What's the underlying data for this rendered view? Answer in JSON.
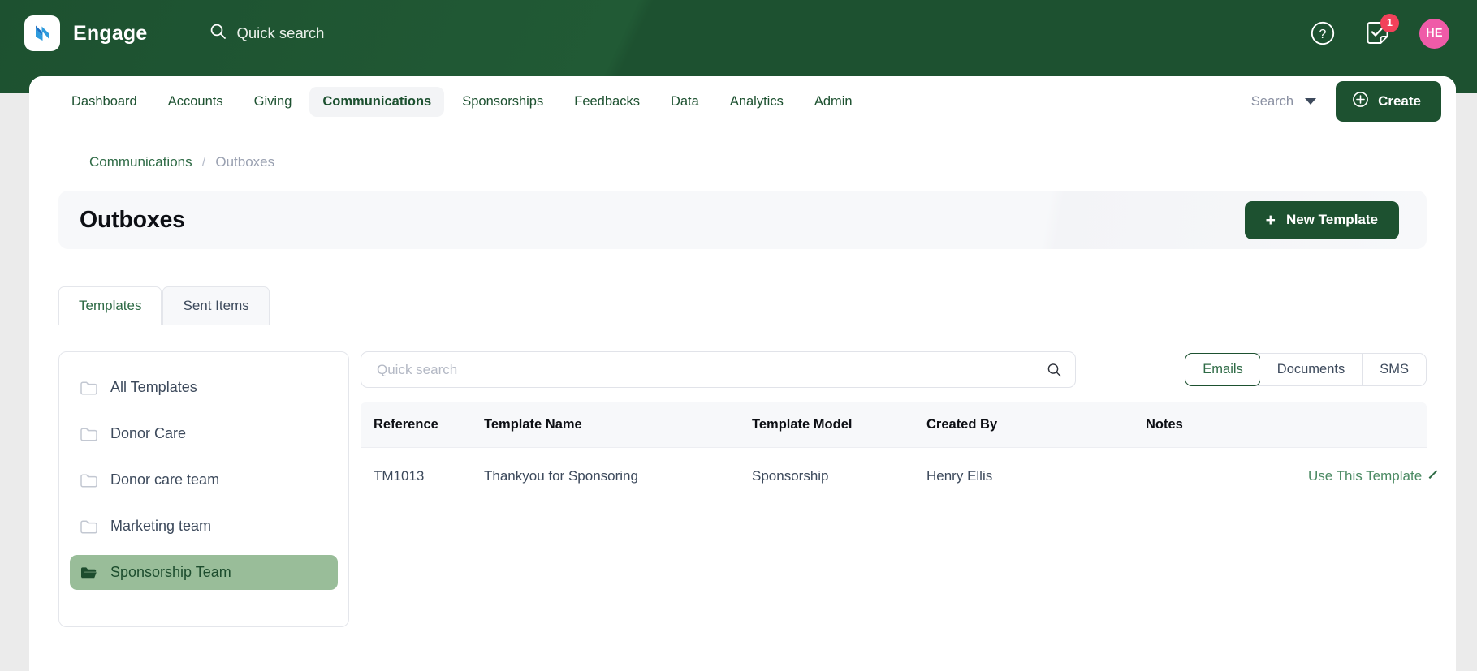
{
  "topbar": {
    "logo_icon": "engage-wave-logo-icon",
    "brand": "Engage",
    "quick_search_label": "Quick search",
    "quick_search_icon": "search-icon",
    "help_icon": "help-circle-icon",
    "tasks_icon": "task-checklist-icon",
    "tasks_badge": "1",
    "avatar_initials": "HE",
    "bg_color": "#1d5130",
    "badge_color": "#f2415a",
    "avatar_color": "#ef5ba8"
  },
  "nav": {
    "items": [
      {
        "label": "Dashboard",
        "active": false
      },
      {
        "label": "Accounts",
        "active": false
      },
      {
        "label": "Giving",
        "active": false
      },
      {
        "label": "Communications",
        "active": true
      },
      {
        "label": "Sponsorships",
        "active": false
      },
      {
        "label": "Feedbacks",
        "active": false
      },
      {
        "label": "Data",
        "active": false
      },
      {
        "label": "Analytics",
        "active": false
      },
      {
        "label": "Admin",
        "active": false
      }
    ],
    "search_dropdown_label": "Search",
    "search_dropdown_icon": "chevron-down-icon",
    "create_label": "Create",
    "create_icon": "plus-circle-icon"
  },
  "breadcrumb": {
    "parent": "Communications",
    "separator": "/",
    "current": "Outboxes"
  },
  "header": {
    "title": "Outboxes",
    "new_template_label": "New Template",
    "new_template_icon": "plus-icon"
  },
  "tabs": [
    {
      "label": "Templates",
      "active": true
    },
    {
      "label": "Sent Items",
      "active": false
    }
  ],
  "folders": {
    "items": [
      {
        "label": "All Templates",
        "icon": "folder-closed-icon",
        "selected": false
      },
      {
        "label": "Donor Care",
        "icon": "folder-closed-icon",
        "selected": false
      },
      {
        "label": "Donor care team",
        "icon": "folder-closed-icon",
        "selected": false
      },
      {
        "label": "Marketing team",
        "icon": "folder-closed-icon",
        "selected": false
      },
      {
        "label": "Sponsorship Team",
        "icon": "folder-open-icon",
        "selected": true
      }
    ],
    "selected_bg": "#99bd99"
  },
  "toolbar": {
    "search_placeholder": "Quick search",
    "search_value": "",
    "search_icon": "search-icon",
    "filters": [
      {
        "label": "Emails",
        "active": true
      },
      {
        "label": "Documents",
        "active": false
      },
      {
        "label": "SMS",
        "active": false
      }
    ]
  },
  "table": {
    "columns": [
      "Reference",
      "Template Name",
      "Template Model",
      "Created By",
      "Notes",
      ""
    ],
    "rows": [
      {
        "reference": "TM1013",
        "template_name": "Thankyou for Sponsoring",
        "template_model": "Sponsorship",
        "created_by": "Henry Ellis",
        "notes": "",
        "action_label": "Use This Template",
        "action_icon": "chevron-down-icon"
      }
    ]
  }
}
